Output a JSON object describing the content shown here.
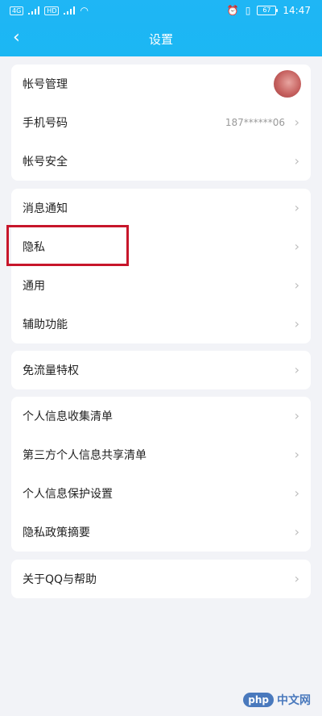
{
  "status_bar": {
    "left_badges": [
      "4G",
      "HD"
    ],
    "time": "14:47",
    "battery": "67"
  },
  "nav": {
    "back_icon": "chevron-left-icon",
    "title": "设置"
  },
  "groups": [
    {
      "items": [
        {
          "label": "帐号管理",
          "value": "",
          "trailing": "avatar"
        },
        {
          "label": "手机号码",
          "value": "187******06",
          "trailing": "chevron"
        },
        {
          "label": "帐号安全",
          "value": "",
          "trailing": "chevron"
        }
      ]
    },
    {
      "items": [
        {
          "label": "消息通知",
          "value": "",
          "trailing": "chevron"
        },
        {
          "label": "隐私",
          "value": "",
          "trailing": "chevron"
        },
        {
          "label": "通用",
          "value": "",
          "trailing": "chevron"
        },
        {
          "label": "辅助功能",
          "value": "",
          "trailing": "chevron"
        }
      ]
    },
    {
      "items": [
        {
          "label": "免流量特权",
          "value": "",
          "trailing": "chevron"
        }
      ]
    },
    {
      "items": [
        {
          "label": "个人信息收集清单",
          "value": "",
          "trailing": "chevron"
        },
        {
          "label": "第三方个人信息共享清单",
          "value": "",
          "trailing": "chevron"
        },
        {
          "label": "个人信息保护设置",
          "value": "",
          "trailing": "chevron"
        },
        {
          "label": "隐私政策摘要",
          "value": "",
          "trailing": "chevron"
        }
      ]
    },
    {
      "items": [
        {
          "label": "关于QQ与帮助",
          "value": "",
          "trailing": "chevron"
        }
      ]
    }
  ],
  "watermark": {
    "logo": "php",
    "text": "中文网"
  },
  "colors": {
    "header": "#1fb6f5",
    "highlight": "#c7162b",
    "background": "#f2f3f7"
  }
}
